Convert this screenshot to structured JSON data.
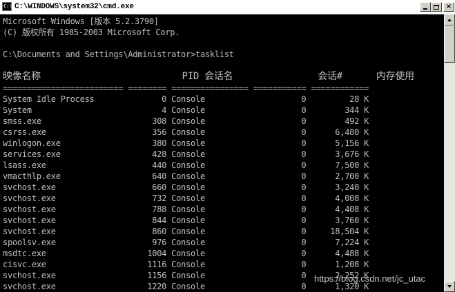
{
  "window": {
    "title": "C:\\WINDOWS\\system32\\cmd.exe",
    "controls": {
      "minimize": "_",
      "maximize": "□",
      "close": "×"
    }
  },
  "console": {
    "lines": [
      "Microsoft Windows [版本 5.2.3790]",
      "(C) 版权所有 1985-2003 Microsoft Corp.",
      "",
      "C:\\Documents and Settings\\Administrator>tasklist",
      "",
      "映像名称                         PID 会话名               会话#      内存使用",
      "========================= ======== ================ =========== ============",
      "System Idle Process              0 Console                    0         28 K",
      "System                           4 Console                    0        344 K",
      "smss.exe                       308 Console                    0        492 K",
      "csrss.exe                      356 Console                    0      6,480 K",
      "winlogon.exe                   380 Console                    0      5,156 K",
      "services.exe                   428 Console                    0      3,676 K",
      "lsass.exe                      440 Console                    0      7,500 K",
      "vmacthlp.exe                   640 Console                    0      2,700 K",
      "svchost.exe                    660 Console                    0      3,240 K",
      "svchost.exe                    732 Console                    0      4,008 K",
      "svchost.exe                    788 Console                    0      4,408 K",
      "svchost.exe                    844 Console                    0      3,760 K",
      "svchost.exe                    860 Console                    0     18,504 K",
      "spoolsv.exe                    976 Console                    0      7,224 K",
      "msdtc.exe                     1004 Console                    0      4,488 K",
      "cisvc.exe                     1116 Console                    0      1,208 K",
      "svchost.exe                   1156 Console                    0      2,252 K",
      "svchost.exe                   1220 Console                    0      1,320 K"
    ]
  },
  "watermark": "https://blog.csdn.net/jc_utac"
}
